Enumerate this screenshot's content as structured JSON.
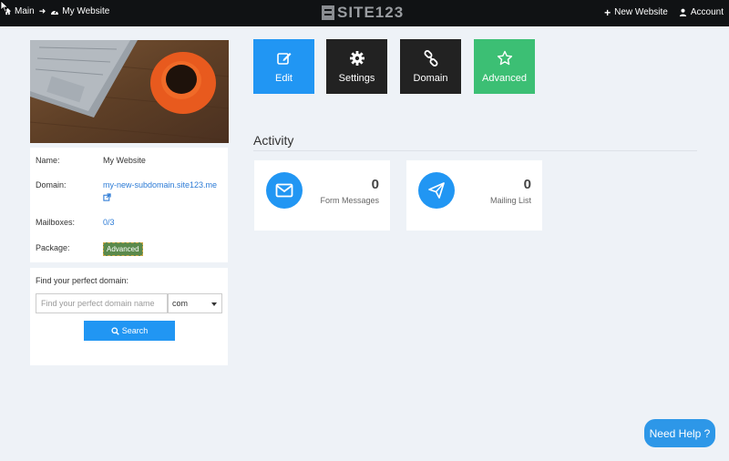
{
  "topbar": {
    "breadcrumb": {
      "main_label": "Main",
      "site_label": "My Website"
    },
    "logo_text": "SITE123",
    "new_website_label": "New Website",
    "account_label": "Account"
  },
  "website": {
    "name_label": "Name:",
    "name_value": "My Website",
    "domain_label": "Domain:",
    "domain_value": "my-new-subdomain.site123.me",
    "mailboxes_label": "Mailboxes:",
    "mailboxes_value": "0/3",
    "package_label": "Package:",
    "package_value": "Advanced"
  },
  "domain_search": {
    "title": "Find your perfect domain:",
    "placeholder": "Find your perfect domain name",
    "tld_selected": "com",
    "search_label": "Search"
  },
  "actions": [
    {
      "label": "Edit",
      "icon": "edit-icon",
      "color": "#2196f3"
    },
    {
      "label": "Settings",
      "icon": "gear-icon",
      "color": "#222222"
    },
    {
      "label": "Domain",
      "icon": "link-icon",
      "color": "#222222"
    },
    {
      "label": "Advanced",
      "icon": "star-icon",
      "color": "#3cbf74"
    }
  ],
  "activity": {
    "title": "Activity",
    "cards": [
      {
        "count": "0",
        "label": "Form Messages",
        "icon": "envelope-icon"
      },
      {
        "count": "0",
        "label": "Mailing List",
        "icon": "paper-plane-icon"
      }
    ]
  },
  "help": {
    "label": "Need Help ?"
  }
}
